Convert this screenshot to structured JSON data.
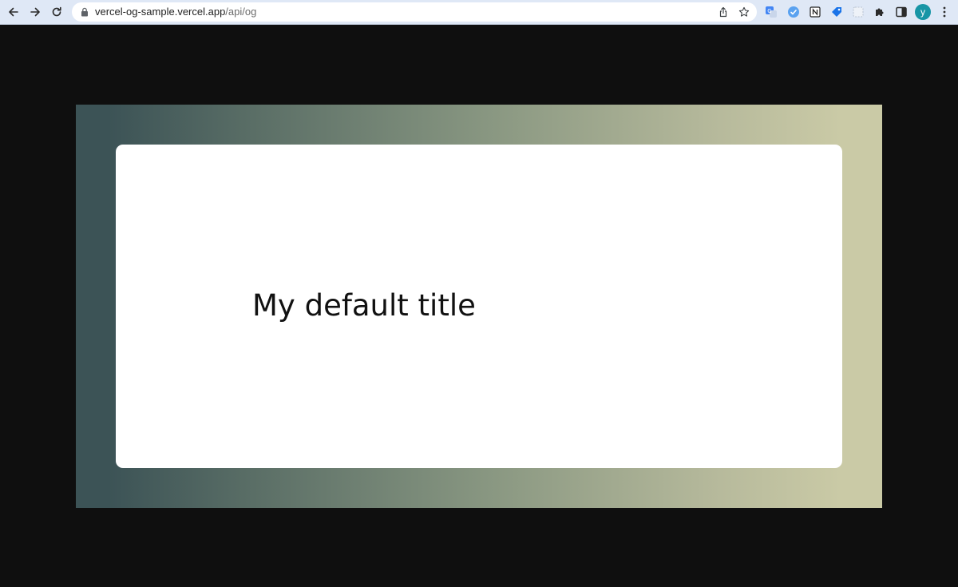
{
  "browser": {
    "url": {
      "host": "vercel-og-sample.vercel.app",
      "path": "/api/og"
    },
    "profile_initial": "y",
    "icons": {
      "back": "back-arrow-icon",
      "forward": "forward-arrow-icon",
      "reload": "reload-icon",
      "lock": "lock-icon",
      "share": "share-icon",
      "bookmark": "star-icon",
      "extensions": [
        "translate-extension-icon",
        "vpn-extension-icon",
        "notion-extension-icon",
        "tag-extension-icon",
        "screenshot-extension-icon",
        "puzzle-icon",
        "side-panel-icon"
      ],
      "menu": "kebab-menu-icon"
    },
    "colors": {
      "toolbar": "#dfe8f6",
      "avatar": "#1795a6"
    }
  },
  "page": {
    "title": "My default title",
    "colors": {
      "background": "#0f0f0f",
      "gradient_start": "#3c5356",
      "gradient_end": "#cacaa6",
      "card": "#ffffff"
    }
  }
}
